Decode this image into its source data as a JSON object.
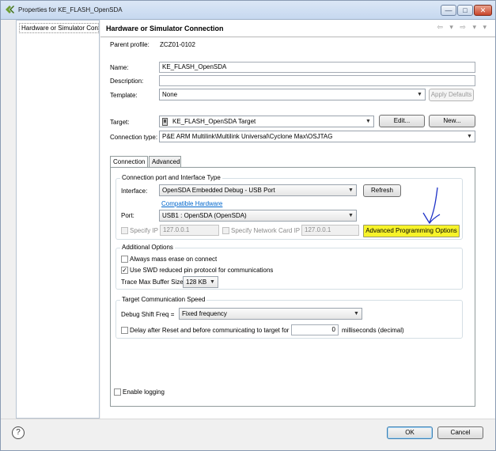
{
  "window": {
    "title": "Properties for KE_FLASH_OpenSDA",
    "min_label": "—",
    "max_label": "□",
    "close_label": "✕"
  },
  "tree": {
    "selected": "Hardware or Simulator Conn"
  },
  "header": {
    "title": "Hardware or Simulator Connection",
    "nav": "⇦ ▾ ⇨ ▾ ▾"
  },
  "form": {
    "parent_profile_label": "Parent profile:",
    "parent_profile_value": "ZCZ01-0102",
    "name_label": "Name:",
    "name_value": "KE_FLASH_OpenSDA",
    "description_label": "Description:",
    "description_value": "",
    "template_label": "Template:",
    "template_value": "None",
    "apply_defaults": "Apply Defaults",
    "target_label": "Target:",
    "target_value": "KE_FLASH_OpenSDA Target",
    "edit_button": "Edit...",
    "new_button": "New...",
    "connection_type_label": "Connection type:",
    "connection_type_value": "P&E ARM Multilink\\Multilink Universal\\Cyclone Max\\OSJTAG"
  },
  "tabs": [
    "Connection",
    "Advanced"
  ],
  "connection": {
    "port_group_label": "Connection port and Interface Type",
    "interface_label": "Interface:",
    "interface_value": "OpenSDA Embedded Debug - USB Port",
    "refresh_button": "Refresh",
    "compatible_link": "Compatible Hardware",
    "port_label": "Port:",
    "port_value": "USB1 : OpenSDA (OpenSDA)",
    "specify_ip_label": "Specify IP",
    "specify_ip_value": "127.0.0.1",
    "specify_nic_label": "Specify Network Card IP",
    "specify_nic_value": "127.0.0.1",
    "advanced_prog_button": "Advanced Programming Options"
  },
  "additional": {
    "group_label": "Additional Options",
    "mass_erase_label": "Always mass erase on connect",
    "mass_erase_checked": false,
    "swd_label": "Use SWD reduced pin protocol for communications",
    "swd_checked": true,
    "trace_label": "Trace Max Buffer Size:",
    "trace_value": "128 KB"
  },
  "speed": {
    "group_label": "Target Communication Speed",
    "shift_label": "Debug Shift Freq =",
    "shift_value": "Fixed frequency",
    "delay_label": "Delay after Reset and before communicating to target for",
    "delay_value": "0",
    "delay_unit": "milliseconds (decimal)"
  },
  "logging": {
    "label": "Enable logging",
    "checked": false
  },
  "footer": {
    "help": "?",
    "ok": "OK",
    "cancel": "Cancel"
  },
  "colors": {
    "highlight": "#f7f329",
    "annotation": "#1e32c8",
    "link": "#0066cc"
  }
}
